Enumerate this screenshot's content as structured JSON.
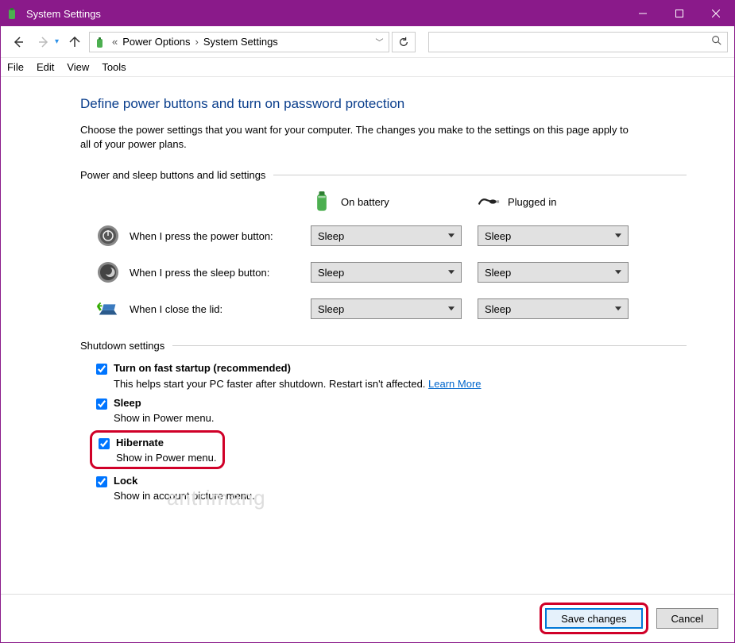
{
  "titlebar": {
    "title": "System Settings"
  },
  "breadcrumb": {
    "parent": "Power Options",
    "current": "System Settings",
    "prefix": "«"
  },
  "menubar": {
    "file": "File",
    "edit": "Edit",
    "view": "View",
    "tools": "Tools"
  },
  "page": {
    "heading": "Define power buttons and turn on password protection",
    "description": "Choose the power settings that you want for your computer. The changes you make to the settings on this page apply to all of your power plans.",
    "section_power_lid": "Power and sleep buttons and lid settings",
    "col_battery": "On battery",
    "col_plugged": "Plugged in",
    "rows": {
      "power_button": {
        "label": "When I press the power button:",
        "battery": "Sleep",
        "plugged": "Sleep"
      },
      "sleep_button": {
        "label": "When I press the sleep button:",
        "battery": "Sleep",
        "plugged": "Sleep"
      },
      "lid": {
        "label": "When I close the lid:",
        "battery": "Sleep",
        "plugged": "Sleep"
      }
    },
    "section_shutdown": "Shutdown settings",
    "shutdown": {
      "fast_startup": {
        "label": "Turn on fast startup (recommended)",
        "desc": "This helps start your PC faster after shutdown. Restart isn't affected. ",
        "link": "Learn More"
      },
      "sleep": {
        "label": "Sleep",
        "desc": "Show in Power menu."
      },
      "hibernate": {
        "label": "Hibernate",
        "desc": "Show in Power menu."
      },
      "lock": {
        "label": "Lock",
        "desc": "Show in account picture menu."
      }
    }
  },
  "footer": {
    "save": "Save changes",
    "cancel": "Cancel"
  },
  "watermark": "antrimang"
}
